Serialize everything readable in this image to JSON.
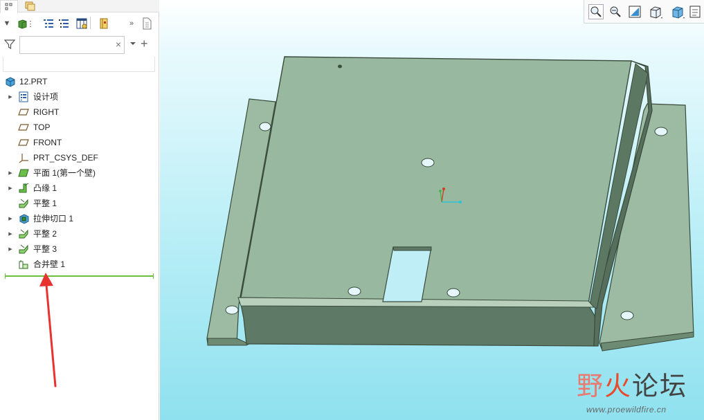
{
  "search": {
    "value": "",
    "placeholder": ""
  },
  "tree": [
    {
      "label": "12.PRT",
      "icon": "part-icon",
      "expandable": false
    },
    {
      "label": "设计项",
      "icon": "design-items-icon",
      "expandable": true
    },
    {
      "label": "RIGHT",
      "icon": "datum-plane-icon",
      "expandable": false
    },
    {
      "label": "TOP",
      "icon": "datum-plane-icon",
      "expandable": false
    },
    {
      "label": "FRONT",
      "icon": "datum-plane-icon",
      "expandable": false
    },
    {
      "label": "PRT_CSYS_DEF",
      "icon": "coordinate-system-icon",
      "expandable": false
    },
    {
      "label": "平面 1(第一个壁)",
      "icon": "planar-wall-icon",
      "expandable": true
    },
    {
      "label": "凸缘 1",
      "icon": "flange-wall-icon",
      "expandable": true
    },
    {
      "label": "平整 1",
      "icon": "flat-wall-icon",
      "expandable": false
    },
    {
      "label": "拉伸切口 1",
      "icon": "extrude-cut-icon",
      "expandable": true
    },
    {
      "label": "平整 2",
      "icon": "flat-wall-icon",
      "expandable": true
    },
    {
      "label": "平整 3",
      "icon": "flat-wall-icon",
      "expandable": true
    },
    {
      "label": "合并壁 1",
      "icon": "merge-wall-icon",
      "expandable": false
    }
  ],
  "watermark": {
    "logo_left": "野",
    "logo_fire": "火",
    "logo_right": "论坛",
    "url": "www.proewildfire.cn"
  },
  "colors": {
    "model_top": "#98b8a0",
    "model_side": "#5f7a66",
    "annotation_arrow": "#e8322f",
    "insert_line": "#6bbf3c"
  }
}
